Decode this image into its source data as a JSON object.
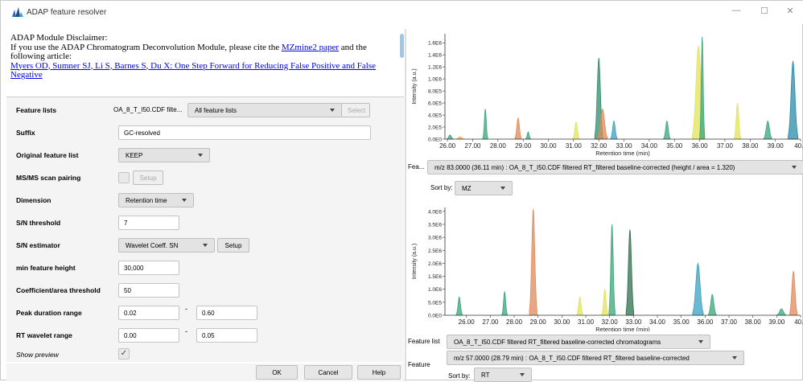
{
  "window": {
    "title": "ADAP feature resolver",
    "minimize": "—",
    "maximize": "☐",
    "close": "✕"
  },
  "disclaimer": {
    "heading": "ADAP Module Disclaimer:",
    "line1_pre": "If you use the ADAP Chromatogram Deconvolution Module, please cite the ",
    "line1_link": "MZmine2 paper",
    "line1_post": " and the following article:",
    "article_link": "Myers OD, Sumner SJ, Li S, Barnes S, Du X: One Step Forward for Reducing False Positive and False Negative"
  },
  "form": {
    "feature_lists": {
      "label": "Feature lists",
      "value": "OA_8_T_I50.CDF filte...",
      "dropdown": "All feature lists",
      "select_btn": "Select"
    },
    "suffix": {
      "label": "Suffix",
      "value": "GC-resolved"
    },
    "original": {
      "label": "Original feature list",
      "value": "KEEP"
    },
    "msms": {
      "label": "MS/MS scan pairing",
      "setup": "Setup"
    },
    "dimension": {
      "label": "Dimension",
      "value": "Retention time"
    },
    "sn_threshold": {
      "label": "S/N threshold",
      "value": "7"
    },
    "sn_estimator": {
      "label": "S/N estimator",
      "value": "Wavelet Coeff. SN",
      "setup": "Setup"
    },
    "min_height": {
      "label": "min feature height",
      "value": "30,000"
    },
    "coeff_area": {
      "label": "Coefficient/area threshold",
      "value": "50"
    },
    "peak_duration": {
      "label": "Peak duration range",
      "min": "0.02",
      "max": "0.60",
      "sep": "-"
    },
    "rt_wavelet": {
      "label": "RT wavelet range",
      "min": "0.00",
      "max": "0.05",
      "sep": "-"
    },
    "show_preview": {
      "label": "Show preview",
      "check": "✓"
    }
  },
  "buttons": {
    "ok": "OK",
    "cancel": "Cancel",
    "help": "Help"
  },
  "right": {
    "feature_top_label": "Fea...",
    "feature_top_value": "m/z 83.0000 (36.11 min) : OA_8_T_I50.CDF filtered RT_filtered baseline-corrected (height / area = 1.320)",
    "sort_top_label": "Sort by:",
    "sort_top_value": "MZ",
    "feature_list_label": "Feature list",
    "feature_list_value": "OA_8_T_I50.CDF filtered RT_filtered baseline-corrected chromatograms",
    "feature_label": "Feature",
    "feature_value": "m/z 57.0000 (28.79 min) : OA_8_T_I50.CDF filtered RT_filtered baseline-corrected",
    "sort_bottom_label": "Sort by:",
    "sort_bottom_value": "RT"
  },
  "chart_data": [
    {
      "type": "area",
      "xlabel": "Retention time (min)",
      "ylabel": "Intensity (a.u.)",
      "xlim": [
        25.9,
        40.0
      ],
      "ylim": [
        0,
        1750000.0
      ],
      "xticks": [
        "26.00",
        "27.00",
        "28.00",
        "29.00",
        "30.00",
        "31.00",
        "32.00",
        "33.00",
        "34.00",
        "35.00",
        "36.00",
        "37.00",
        "38.00",
        "39.00",
        "40.0"
      ],
      "yticks": [
        "0.0E0",
        "2.0E5",
        "4.0E5",
        "6.0E5",
        "8.0E5",
        "1.0E6",
        "1.2E6",
        "1.4E6",
        "1.6E6"
      ],
      "peaks": [
        {
          "x": 26.1,
          "h": 70000,
          "w": 0.08,
          "color": "#3aa57a"
        },
        {
          "x": 26.5,
          "h": 40000,
          "w": 0.1,
          "color": "#e7b24b"
        },
        {
          "x": 27.5,
          "h": 500000,
          "w": 0.06,
          "color": "#3aa57a"
        },
        {
          "x": 28.8,
          "h": 350000,
          "w": 0.08,
          "color": "#e08a5a"
        },
        {
          "x": 29.2,
          "h": 120000,
          "w": 0.06,
          "color": "#3aa57a"
        },
        {
          "x": 31.1,
          "h": 280000,
          "w": 0.08,
          "color": "#e2e35a"
        },
        {
          "x": 32.0,
          "h": 1350000,
          "w": 0.1,
          "color": "#2f8c6a"
        },
        {
          "x": 32.15,
          "h": 500000,
          "w": 0.12,
          "color": "#e08a5a"
        },
        {
          "x": 32.6,
          "h": 300000,
          "w": 0.08,
          "color": "#3b9fc2"
        },
        {
          "x": 34.7,
          "h": 300000,
          "w": 0.08,
          "color": "#3aa57a"
        },
        {
          "x": 35.95,
          "h": 1550000,
          "w": 0.15,
          "color": "#e2e35a"
        },
        {
          "x": 36.1,
          "h": 1700000,
          "w": 0.06,
          "color": "#3aa57a"
        },
        {
          "x": 37.5,
          "h": 600000,
          "w": 0.08,
          "color": "#e2e35a"
        },
        {
          "x": 38.7,
          "h": 300000,
          "w": 0.1,
          "color": "#3aa57a"
        },
        {
          "x": 39.7,
          "h": 1300000,
          "w": 0.12,
          "color": "#2a8ba8"
        }
      ]
    },
    {
      "type": "area",
      "xlabel": "Retention time (min)",
      "ylabel": "Intensity (a.u.)",
      "xlim": [
        25.1,
        40.0
      ],
      "ylim": [
        0,
        4150000.0
      ],
      "xticks": [
        "26.00",
        "27.00",
        "28.00",
        "29.00",
        "30.00",
        "31.00",
        "32.00",
        "33.00",
        "34.00",
        "35.00",
        "36.00",
        "37.00",
        "38.00",
        "39.00",
        "40.0"
      ],
      "yticks": [
        "0.0E0",
        "5.0E5",
        "1.0E6",
        "1.5E6",
        "2.0E6",
        "2.5E6",
        "3.0E6",
        "3.5E6",
        "4.0E6"
      ],
      "peaks": [
        {
          "x": 25.7,
          "h": 700000,
          "w": 0.08,
          "color": "#3aa57a"
        },
        {
          "x": 27.6,
          "h": 900000,
          "w": 0.07,
          "color": "#3aa57a"
        },
        {
          "x": 28.8,
          "h": 4100000,
          "w": 0.1,
          "color": "#e08a5a"
        },
        {
          "x": 30.75,
          "h": 700000,
          "w": 0.08,
          "color": "#e2e35a"
        },
        {
          "x": 31.8,
          "h": 1000000,
          "w": 0.08,
          "color": "#e2e35a"
        },
        {
          "x": 32.1,
          "h": 3500000,
          "w": 0.08,
          "color": "#3aa57a"
        },
        {
          "x": 32.85,
          "h": 3300000,
          "w": 0.1,
          "color": "#2f6f4f"
        },
        {
          "x": 35.7,
          "h": 2000000,
          "w": 0.14,
          "color": "#3b9fc2"
        },
        {
          "x": 36.3,
          "h": 800000,
          "w": 0.1,
          "color": "#3aa57a"
        },
        {
          "x": 39.2,
          "h": 250000,
          "w": 0.12,
          "color": "#3aa57a"
        },
        {
          "x": 39.7,
          "h": 1700000,
          "w": 0.1,
          "color": "#e08a5a"
        }
      ]
    }
  ]
}
